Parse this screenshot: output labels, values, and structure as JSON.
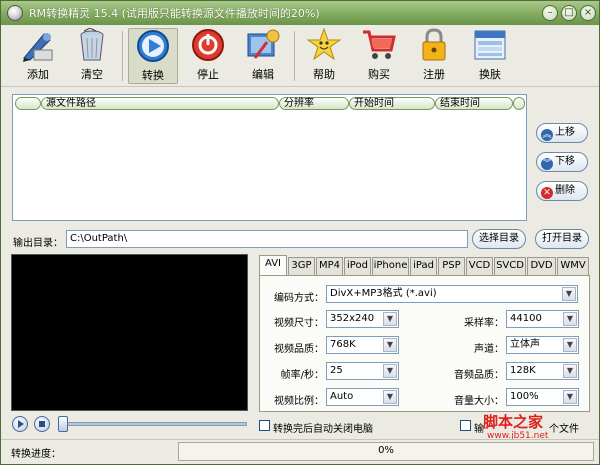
{
  "window": {
    "title": "RM转换精灵 15.4 (试用版只能转换源文件播放时间的20%)",
    "minimize_icon": "minimize-icon",
    "maximize_icon": "maximize-icon",
    "close_icon": "close-icon"
  },
  "toolbar": {
    "items": [
      {
        "label": "添加",
        "icon": "add-pen-icon"
      },
      {
        "label": "清空",
        "icon": "trash-bin-icon"
      },
      {
        "label": "转换",
        "icon": "play-convert-icon"
      },
      {
        "label": "停止",
        "icon": "stop-power-icon"
      },
      {
        "label": "编辑",
        "icon": "edit-tools-icon"
      },
      {
        "label": "帮助",
        "icon": "help-star-icon"
      },
      {
        "label": "购买",
        "icon": "shopping-cart-icon"
      },
      {
        "label": "注册",
        "icon": "lock-icon"
      },
      {
        "label": "换肤",
        "icon": "skin-window-icon"
      }
    ]
  },
  "file_list": {
    "columns": [
      "",
      "源文件路径",
      "分辨率",
      "开始时间",
      "结束时间",
      ""
    ]
  },
  "side_buttons": {
    "up": "上移",
    "down": "下移",
    "delete": "删除"
  },
  "output": {
    "label": "输出目录：",
    "path": "C:\\OutPath\\",
    "choose_button": "选择目录",
    "open_button": "打开目录"
  },
  "format_tabs": [
    "AVI",
    "3GP",
    "MP4",
    "iPod",
    "iPhone",
    "iPad",
    "PSP",
    "VCD",
    "SVCD",
    "DVD",
    "WMV"
  ],
  "settings": {
    "encoding_label": "编码方式：",
    "encoding_value": "DivX+MP3格式 (*.avi)",
    "size_label": "视频尺寸：",
    "size_value": "352x240",
    "quality_label": "视频品质：",
    "quality_value": "768K",
    "fps_label": "帧率/秒：",
    "fps_value": "25",
    "ratio_label": "视频比例：",
    "ratio_value": "Auto",
    "samplerate_label": "采样率：",
    "samplerate_value": "44100",
    "channel_label": "声道：",
    "channel_value": "立体声",
    "audio_quality_label": "音频品质：",
    "audio_quality_value": "128K",
    "volume_label": "音量大小：",
    "volume_value": "100%"
  },
  "playback": {
    "shutdown_label": "转换完后自动关闭电脑",
    "merge_label_left": "输",
    "merge_label_right": "个文件"
  },
  "status": {
    "progress_label": "转换进度：",
    "progress_value": "0%",
    "progress_fraction": 0
  },
  "watermark": {
    "brand": "脚本之家",
    "url": "www.jb51.net"
  },
  "colors": {
    "title_green": "#7fa85c",
    "watermark_red": "#e0201c"
  }
}
